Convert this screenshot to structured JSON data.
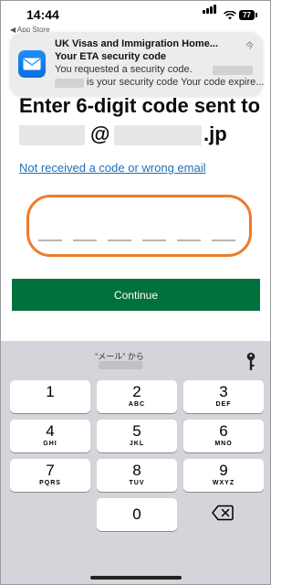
{
  "status_bar": {
    "time": "14:44",
    "back_app": "◀ App Store",
    "battery": "77"
  },
  "notification": {
    "app_name": "UK Visas and Immigration Home...",
    "time": "今",
    "subject": "Your ETA security code",
    "body_line1": "You requested a security code.",
    "body_line2": "is your security code Your code expire..."
  },
  "page": {
    "heading": "Enter 6-digit code sent to",
    "email_at": "@",
    "email_domain": ".jp",
    "resend_link": "Not received a code or wrong email",
    "code_input_value": "",
    "continue_label": "Continue"
  },
  "keyboard": {
    "suggestion_label": "“メール” から",
    "keys": [
      {
        "num": "1",
        "letters": ""
      },
      {
        "num": "2",
        "letters": "ABC"
      },
      {
        "num": "3",
        "letters": "DEF"
      },
      {
        "num": "4",
        "letters": "GHI"
      },
      {
        "num": "5",
        "letters": "JKL"
      },
      {
        "num": "6",
        "letters": "MNO"
      },
      {
        "num": "7",
        "letters": "PQRS"
      },
      {
        "num": "8",
        "letters": "TUV"
      },
      {
        "num": "9",
        "letters": "WXYZ"
      },
      {
        "num": "0",
        "letters": ""
      }
    ]
  },
  "colors": {
    "link": "#1d70b8",
    "continue_bg": "#00703c",
    "focus_ring": "#ef7a2a"
  }
}
